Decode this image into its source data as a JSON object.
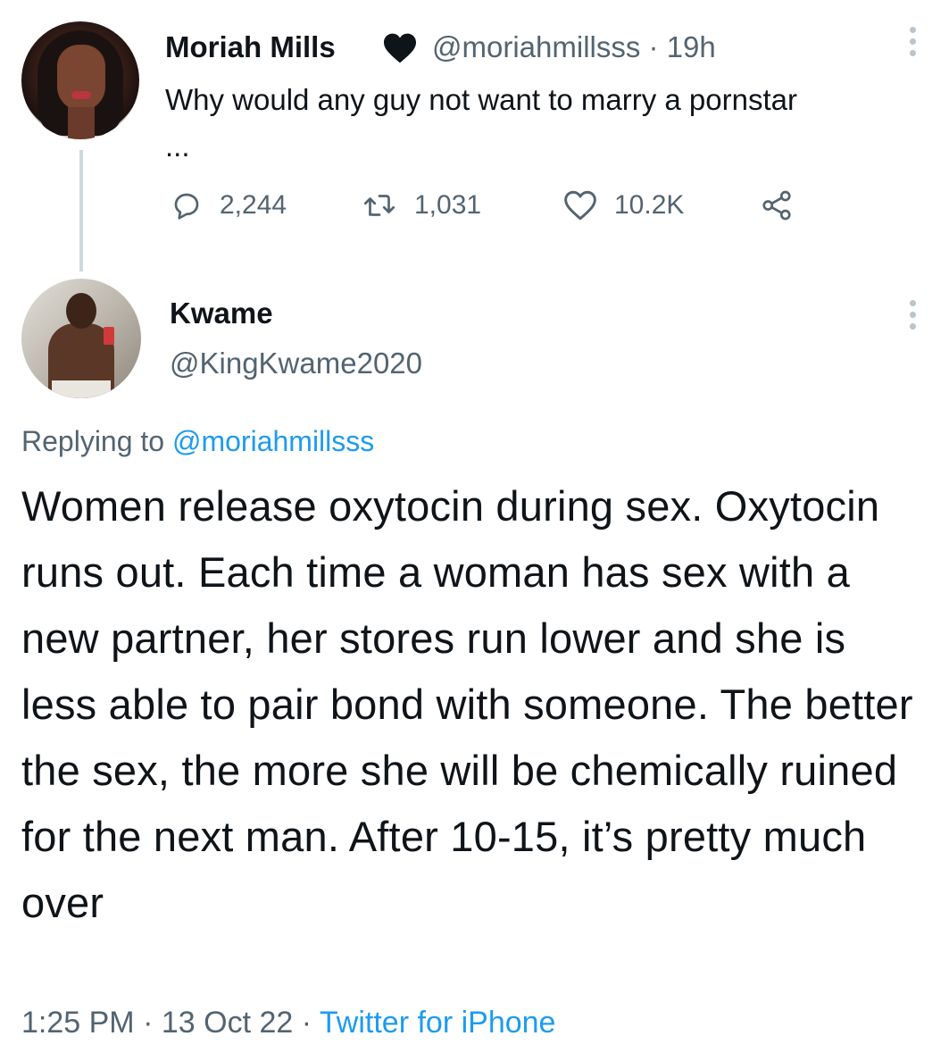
{
  "parent_tweet": {
    "author_name": "Moriah Mills",
    "handle": "@moriahmillsss",
    "separator": "·",
    "time": "19h",
    "text": "Why would any guy not want to marry a pornstar  ...",
    "actions": {
      "replies": "2,244",
      "retweets": "1,031",
      "likes": "10.2K"
    },
    "icons": {
      "badge": "black-heart-icon",
      "reply": "reply-icon",
      "retweet": "retweet-icon",
      "like": "heart-icon",
      "share": "share-icon",
      "more": "more-icon"
    }
  },
  "reply_tweet": {
    "author_name": "Kwame",
    "handle": "@KingKwame2020",
    "replying_prefix": "Replying to",
    "replying_to": "@moriahmillsss",
    "text": "Women release oxytocin during sex. Oxytocin runs out. Each time a woman has sex with a new partner, her stores run lower and she is less able to pair bond with someone. The better the sex, the more she will be chemically ruined for the next man. After 10-15, it’s pretty much over",
    "time": "1:25 PM",
    "separator": "·",
    "date": "13 Oct 22",
    "source": "Twitter for iPhone"
  },
  "colors": {
    "text_primary": "#0f1419",
    "text_secondary": "#536471",
    "link": "#1d9bf0",
    "thread_line": "#cfd9de"
  }
}
